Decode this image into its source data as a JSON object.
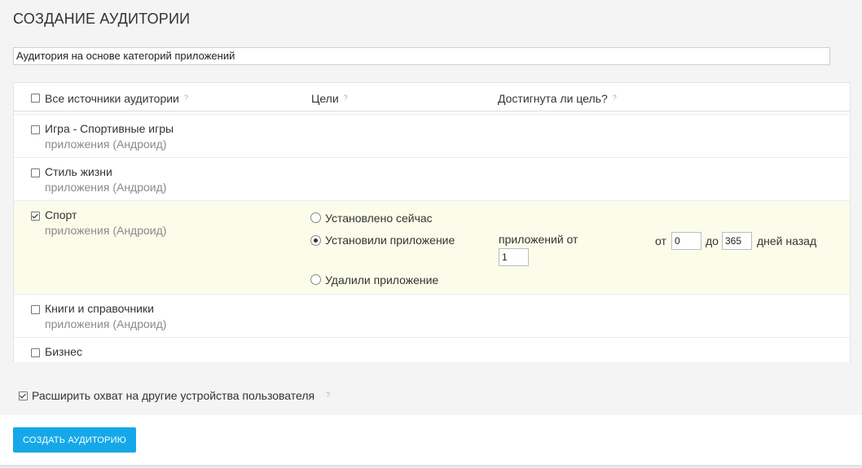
{
  "page": {
    "title": "СОЗДАНИЕ АУДИТОРИИ"
  },
  "audience_name": {
    "value": "Аудитория на основе категорий приложений"
  },
  "table": {
    "headers": {
      "sources": "Все источники аудитории",
      "goals": "Цели",
      "goal_reached": "Достигнута ли цель?",
      "help_mark": "?"
    },
    "rows": [
      {
        "name": "Игра - Спортивные игры",
        "sub": "приложения (Андроид)",
        "checked": false
      },
      {
        "name": "Стиль жизни",
        "sub": "приложения (Андроид)",
        "checked": false
      },
      {
        "name": "Спорт",
        "sub": "приложения (Андроид)",
        "checked": true
      },
      {
        "name": "Книги и справочники",
        "sub": "приложения (Андроид)",
        "checked": false
      },
      {
        "name": "Бизнес",
        "checked": false
      }
    ],
    "sport_options": {
      "installed_now": "Установлено сейчас",
      "installed_app": "Установили приложение",
      "removed_app": "Удалили приложение",
      "apps_from_label": "приложений от",
      "apps_from_value": "1",
      "from_label": "от",
      "from_value": "0",
      "to_label": "до",
      "to_value": "365",
      "days_ago_label": "дней назад",
      "selected_option": "installed_app"
    }
  },
  "expand_reach": {
    "label": "Расширить охват на другие устройства пользователя",
    "help_mark": "?",
    "checked": true
  },
  "footer": {
    "create_button": "СОЗДАТЬ АУДИТОРИЮ"
  },
  "colors": {
    "accent": "#15a8e9",
    "selected_row_bg": "#fbfce9",
    "page_bg": "#f4f4f4"
  }
}
